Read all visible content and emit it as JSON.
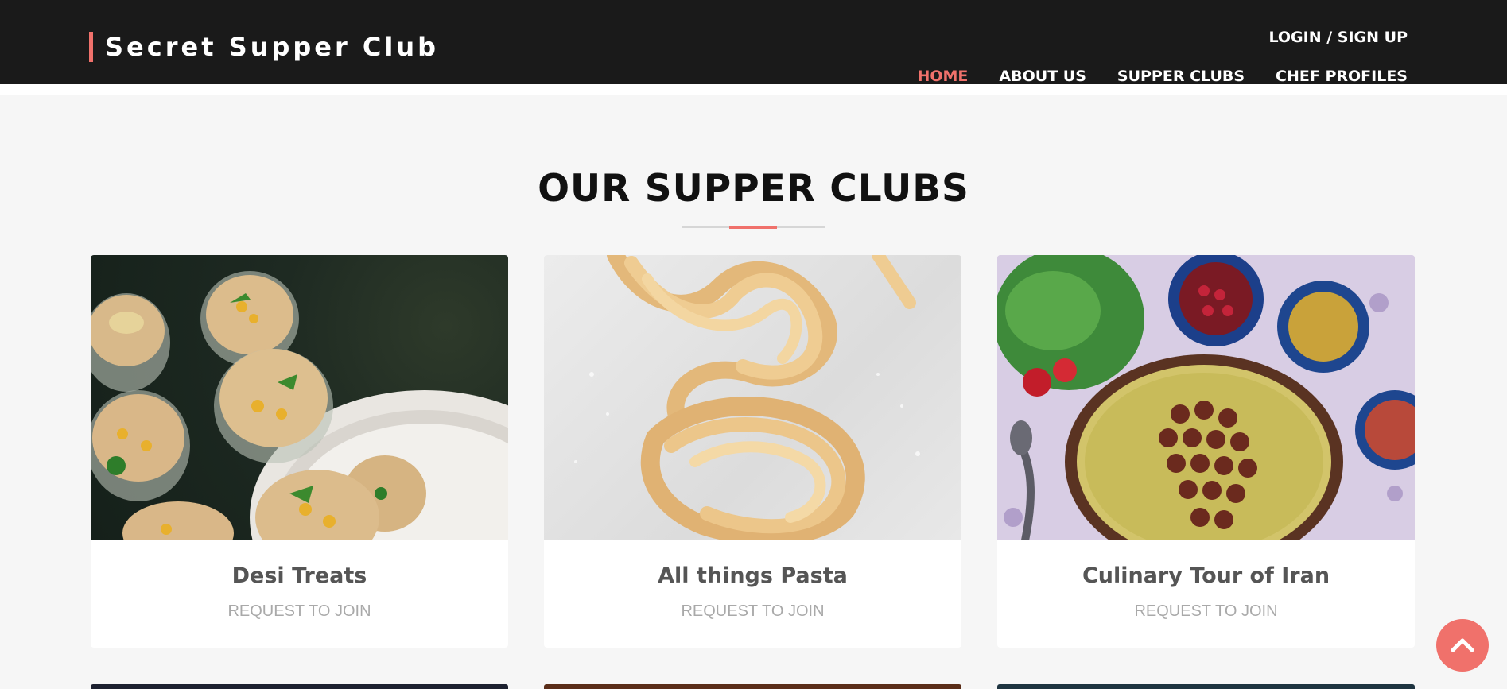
{
  "header": {
    "brand": "Secret Supper Club",
    "login_label": "LOGIN / SIGN UP",
    "nav": [
      {
        "label": "HOME",
        "active": true
      },
      {
        "label": "ABOUT US",
        "active": false
      },
      {
        "label": "SUPPER CLUBS",
        "active": false
      },
      {
        "label": "CHEF PROFILES",
        "active": false
      }
    ]
  },
  "main": {
    "section_title": "OUR SUPPER CLUBS",
    "cards": [
      {
        "title": "Desi Treats",
        "action": "REQUEST TO JOIN",
        "image": "pani-puri-photo"
      },
      {
        "title": "All things Pasta",
        "action": "REQUEST TO JOIN",
        "image": "tagliatelle-nests-photo"
      },
      {
        "title": "Culinary Tour of Iran",
        "action": "REQUEST TO JOIN",
        "image": "persian-rice-kebab-photo"
      }
    ]
  },
  "scroll_top": {
    "icon": "chevron-up-icon"
  },
  "colors": {
    "accent": "#f0716b",
    "header_bg": "#1a1a1a",
    "page_bg": "#f6f6f6",
    "card_title": "#555555",
    "card_link": "#a9a9a9"
  }
}
